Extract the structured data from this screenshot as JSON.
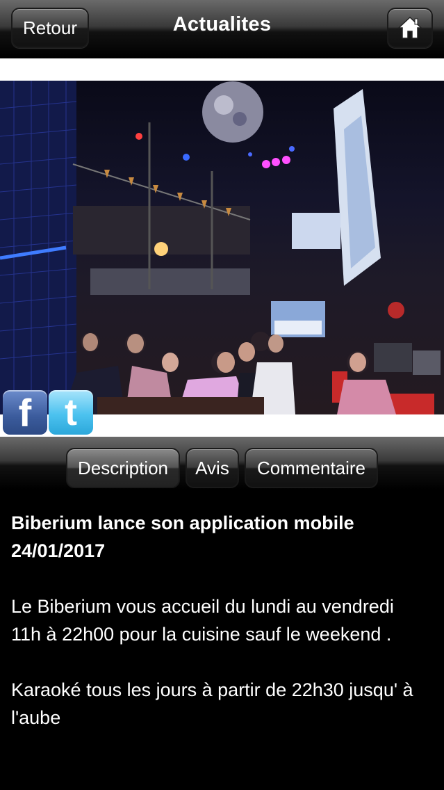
{
  "navbar": {
    "back_label": "Retour",
    "title": "Actualites",
    "home_icon": "home-icon"
  },
  "photo": {
    "alt": "Biberium bar interior"
  },
  "social": {
    "facebook_label": "f",
    "twitter_label": "t"
  },
  "tabs": [
    {
      "label": "Description",
      "active": true
    },
    {
      "label": "Avis",
      "active": false
    },
    {
      "label": "Commentaire",
      "active": false
    }
  ],
  "article": {
    "title": "Biberium lance son application mobile",
    "date": "24/01/2017",
    "paragraphs": [
      "Le Biberium vous accueil du lundi au vendredi 11h à 22h00 pour la cuisine sauf le weekend .",
      "Karaoké tous les jours à partir de 22h30 jusqu' à l'aube"
    ]
  },
  "colors": {
    "background": "#000000",
    "facebook": "#3b5b9c",
    "twitter": "#4cc2ef"
  }
}
